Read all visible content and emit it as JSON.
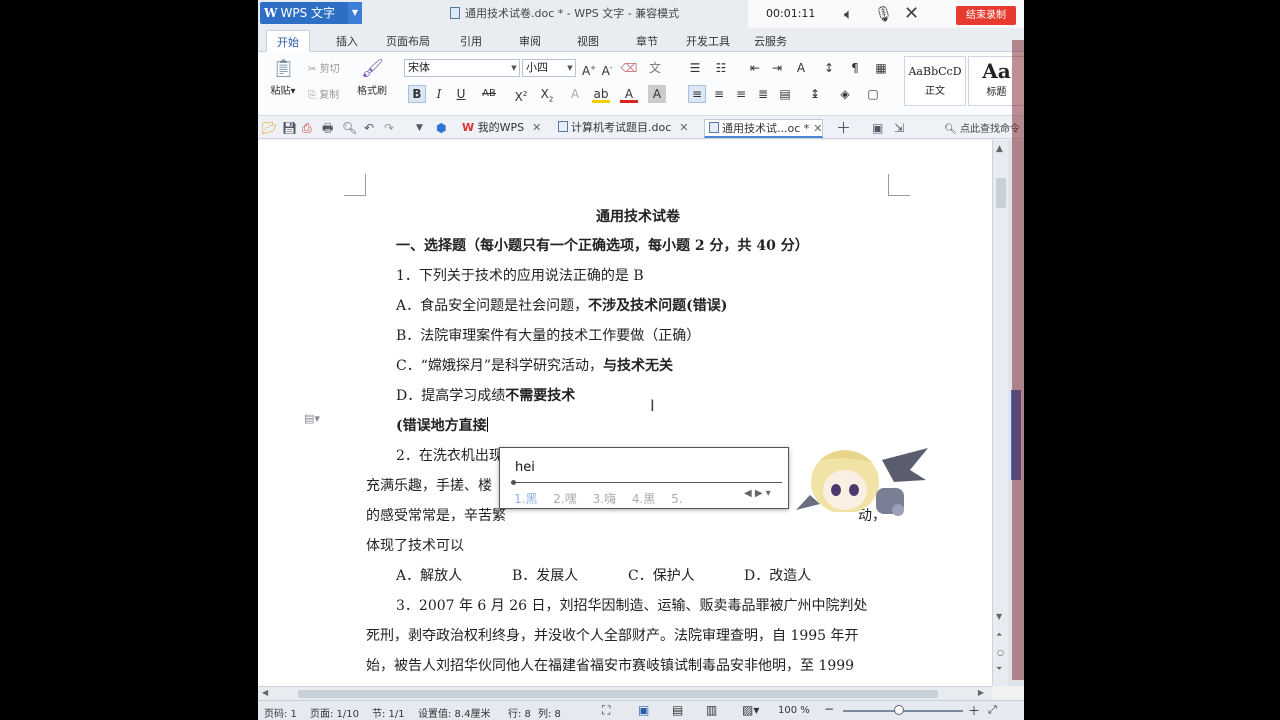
{
  "window": {
    "app_menu": "WPS 文字",
    "doc_title": "通用技术试卷.doc * - WPS 文字 - 兼容模式"
  },
  "recorder": {
    "time": "00:01:11",
    "stop_label": "结束录制"
  },
  "ribbon_tabs": [
    "开始",
    "插入",
    "页面布局",
    "引用",
    "审阅",
    "视图",
    "章节",
    "开发工具",
    "云服务"
  ],
  "ribbon": {
    "paste": "粘贴",
    "cut": "剪切",
    "copy": "复制",
    "format_painter": "格式刷",
    "font_name": "宋体",
    "font_size": "小四",
    "style_normal_preview": "AaBbCcD",
    "style_normal": "正文",
    "style_heading_preview": "Aa",
    "style_heading": "标题"
  },
  "doc_tabs": {
    "my_wps": "我的WPS",
    "tab1": "计算机考试题目.doc",
    "tab2": "通用技术试...oc *",
    "find_command": "点此查找命令"
  },
  "document": {
    "title": "通用技术试卷",
    "section": "一、选择题（每小题只有一个正确选项，每小题 2 分，共 40 分）",
    "q1": "1．下列关于技术的应用说法正确的是 B",
    "q1a_normal": "A．食品安全问题是社会问题，",
    "q1a_bold": "不涉及技术问题(错误)",
    "q1b": "B．法院审理案件有大量的技术工作要做（正确）",
    "q1c_normal": "C．“嫦娥探月”是科学研究活动，",
    "q1c_bold": "与技术无关",
    "q1d_normal": "D．提高学习成绩",
    "q1d_bold": "不需要技术",
    "typing": "(错误地方直接",
    "q2_start": "2．在洗衣机出现",
    "q2_l2": "充满乐趣，手搓、楼",
    "q2_l3": "的感受常常是，辛苦繁",
    "q2_l3_end": "动，",
    "q2_l4": "体现了技术可以",
    "q2_a": "A．解放人",
    "q2_b": "B．发展人",
    "q2_c": "C．保护人",
    "q2_d": "D．改造人",
    "q3_l1": "3．2007 年 6 月 26 日，刘招华因制造、运输、贩卖毒品罪被广州中院判处",
    "q3_l2": "死刑，剥夺政治权利终身，并没收个人全部财产。法院审理查明，自 1995 年开",
    "q3_l3": "始，被告人刘招华伙同他人在福建省福安市赛岐镇试制毒品安非他明，至 1999"
  },
  "ime": {
    "input": "hei",
    "candidates": [
      "1.黑",
      "2.嘿",
      "3.嗨",
      "4.黒",
      "5."
    ]
  },
  "status": {
    "page": "页码: 1",
    "pages": "页面: 1/10",
    "section": "节: 1/1",
    "setting": "设置值: 8.4厘米",
    "row": "行: 8",
    "col": "列: 8",
    "zoom": "100 %"
  },
  "colors": {
    "accent": "#2d6fc5",
    "stop": "#e63b2e"
  }
}
